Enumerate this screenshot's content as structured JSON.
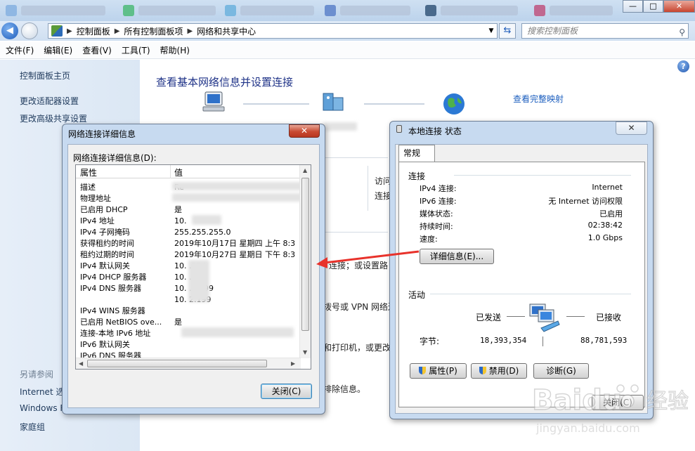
{
  "window": {
    "min_btn": "—",
    "max_btn": "□",
    "close_btn": "✕"
  },
  "address": {
    "crumbs": [
      "控制面板",
      "所有控制面板项",
      "网络和共享中心"
    ],
    "search_placeholder": "搜索控制面板"
  },
  "menu": [
    "文件(F)",
    "编辑(E)",
    "查看(V)",
    "工具(T)",
    "帮助(H)"
  ],
  "left_pane": {
    "links": [
      "控制面板主页",
      "更改适配器设置",
      "更改高级共享设置"
    ],
    "see_also_title": "另请参阅",
    "see_also": [
      "Internet 选",
      "Windows F",
      "家庭组"
    ]
  },
  "main": {
    "title": "查看基本网络信息并设置连接",
    "full_map_link": "查看完整映射",
    "partial": {
      "access": "访问",
      "connect": "连接",
      "conn_or_setup": "连接；或设置路",
      "dialup_vpn": "拨号或 VPN 网络连",
      "printer": "和打印机，或更改",
      "troubleshoot": "排除信息。"
    }
  },
  "details_dialog": {
    "title": "网络连接详细信息",
    "close_x": "✕",
    "list_label": "网络连接详细信息(D):",
    "col_property": "属性",
    "col_value": "值",
    "rows": [
      {
        "k": "描述",
        "v": "Re"
      },
      {
        "k": "物理地址",
        "v": ""
      },
      {
        "k": "已启用 DHCP",
        "v": "是"
      },
      {
        "k": "IPv4 地址",
        "v": "10."
      },
      {
        "k": "IPv4 子网掩码",
        "v": "255.255.255.0"
      },
      {
        "k": "获得租约的时间",
        "v": "2019年10月17日 星期四 上午 8:3"
      },
      {
        "k": "租约过期的时间",
        "v": "2019年10月27日 星期日 下午 8:3"
      },
      {
        "k": "IPv4 默认网关",
        "v": "10.    .254"
      },
      {
        "k": "IPv4 DHCP 服务器",
        "v": "10.    .254"
      },
      {
        "k": "IPv4 DNS 服务器",
        "v": "10.    .1.199"
      },
      {
        "k": "",
        "v": "10.    2.199"
      },
      {
        "k": "IPv4 WINS 服务器",
        "v": ""
      },
      {
        "k": "已启用 NetBIOS ove...",
        "v": "是"
      },
      {
        "k": "连接-本地 IPv6 地址",
        "v": ""
      },
      {
        "k": "IPv6 默认网关",
        "v": ""
      },
      {
        "k": "IPv6 DNS 服务器",
        "v": ""
      }
    ],
    "close_button": "关闭(C)"
  },
  "status_dialog": {
    "title": "本地连接 状态",
    "tab": "常规",
    "connection_title": "连接",
    "fields": [
      {
        "k": "IPv4 连接:",
        "v": "Internet"
      },
      {
        "k": "IPv6 连接:",
        "v": "无 Internet 访问权限"
      },
      {
        "k": "媒体状态:",
        "v": "已启用"
      },
      {
        "k": "持续时间:",
        "v": "02:38:42"
      },
      {
        "k": "速度:",
        "v": "1.0 Gbps"
      }
    ],
    "details_button": "详细信息(E)...",
    "activity_title": "活动",
    "sent_label": "已发送",
    "received_label": "已接收",
    "bytes_label": "字节:",
    "bytes_sent": "18,393,354",
    "bytes_received": "88,781,593",
    "properties_button": "属性(P)",
    "disable_button": "禁用(D)",
    "diagnose_button": "诊断(G)",
    "close_button": "关闭(C)"
  },
  "watermark": {
    "brand": "Baidu",
    "sub": "jingyan.baidu.com",
    "cn": "经验"
  },
  "colors": {
    "link": "#1e395b",
    "title": "#1e3287",
    "arrow": "#e8322b"
  }
}
